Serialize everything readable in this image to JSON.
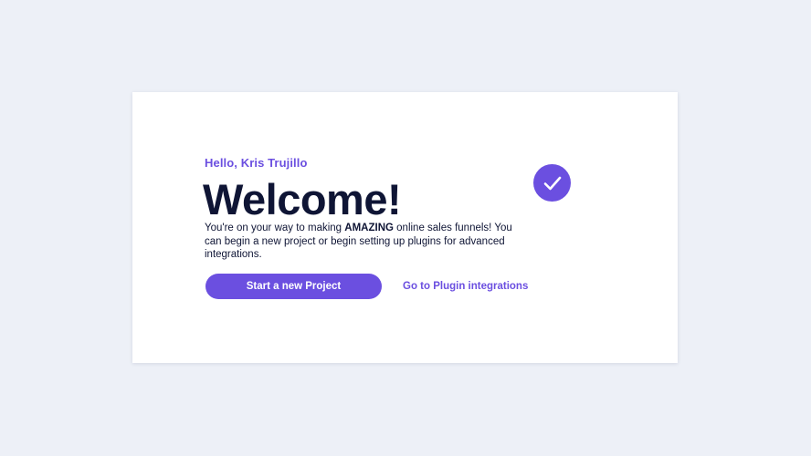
{
  "card": {
    "greeting": "Hello, Kris Trujillo",
    "title": "Welcome!",
    "description": {
      "before": "You're on your way to making ",
      "emphasis": "AMAZING",
      "after": " online sales funnels! You can begin a new project or begin setting up plugins for advanced integrations."
    },
    "primary_button_label": "Start a new Project",
    "secondary_link_label": "Go to Plugin integrations",
    "status_icon": "check-icon"
  },
  "colors": {
    "accent": "#6b4fe0",
    "heading": "#0f1535",
    "page_background": "#edf0f7",
    "card_background": "#ffffff"
  }
}
